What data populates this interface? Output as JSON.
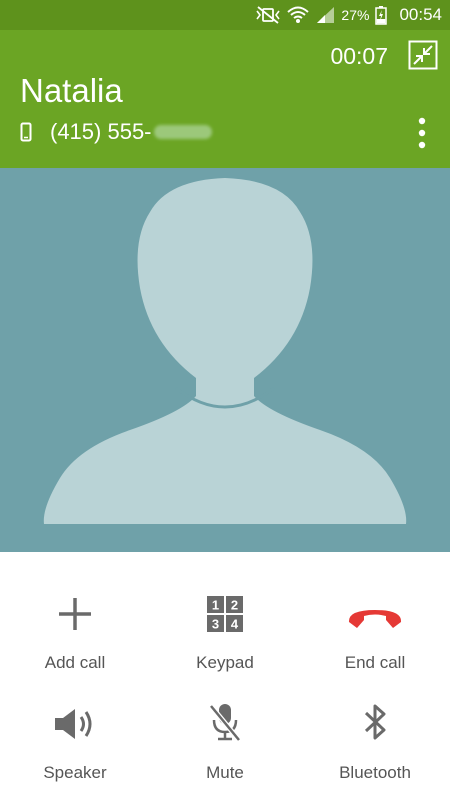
{
  "status_bar": {
    "battery": "27%",
    "time": "00:54",
    "icons": [
      "mute-vibrate-icon",
      "wifi-icon",
      "signal-icon",
      "battery-charging-icon"
    ]
  },
  "call": {
    "timer": "00:07",
    "contact_name": "Natalia",
    "phone_number": "(415) 555-"
  },
  "actions": {
    "add_call": "Add call",
    "keypad": "Keypad",
    "end_call": "End call",
    "speaker": "Speaker",
    "mute": "Mute",
    "bluetooth": "Bluetooth"
  },
  "keypad_digits": [
    "1",
    "2",
    "3",
    "4"
  ],
  "colors": {
    "status_bar": "#5e921c",
    "header": "#6ba524",
    "photo_bg": "#6fa1a9",
    "silhouette": "#b9d3d6",
    "end_call": "#e53935",
    "icon_gray": "#777777"
  }
}
